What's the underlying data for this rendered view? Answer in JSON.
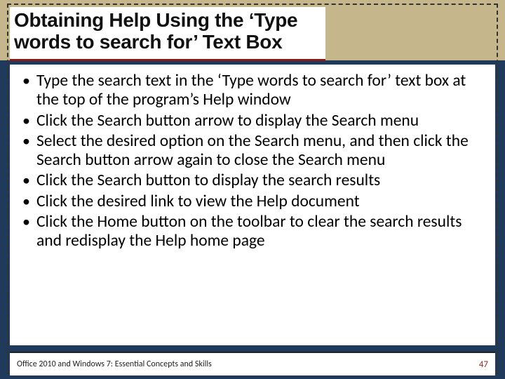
{
  "title": "Obtaining Help Using the ‘Type words to search for’ Text Box",
  "bullets": [
    "Type the search text in the ‘Type words to search for’ text box at the top of the program’s Help window",
    "Click the Search button arrow to display the Search menu",
    "Select the desired option on the Search menu, and then click the Search button arrow again to close the Search menu",
    "Click the Search button to display the search results",
    "Click the desired link to view the Help document",
    "Click the Home button on the toolbar to clear the search results and redisplay the Help home page"
  ],
  "footer": {
    "text": "Office 2010 and Windows 7: Essential Concepts and Skills",
    "page": "47"
  }
}
